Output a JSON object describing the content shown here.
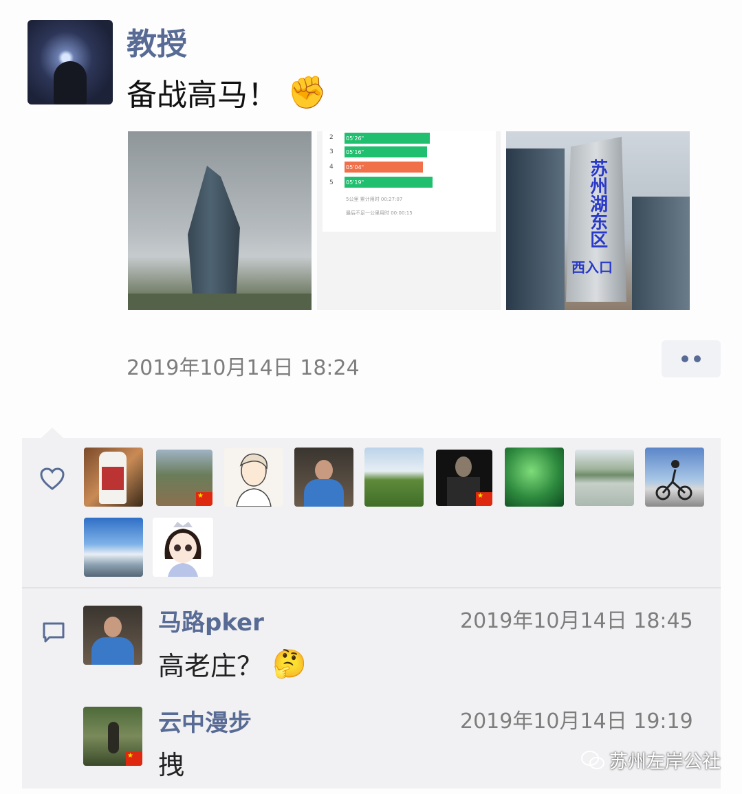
{
  "post": {
    "author": "教授",
    "text": "备战高马！",
    "emoji": "✊",
    "timestamp": "2019年10月14日 18:24",
    "photos": [
      {
        "name": "skyscraper-photo"
      },
      {
        "name": "running-stats-screenshot",
        "rows": [
          "2",
          "3",
          "4",
          "5"
        ],
        "values": [
          "05'26\"",
          "05'16\"",
          "05'04\"",
          "05'19\""
        ],
        "note1": "5公里 累计用时 00:27:07",
        "note2": "最后不足一公里用时 00:00:15"
      },
      {
        "name": "district-sign-photo",
        "sign_text": "苏州湖东区",
        "sign_bottom": "西入口"
      }
    ]
  },
  "likes": {
    "avatars": [
      "liquor-bottle",
      "city-aerial",
      "cartoon-boy",
      "man-blue-shirt",
      "field-landscape",
      "man-dark",
      "green-clover",
      "lake-trees",
      "cyclist",
      "sky-pier",
      "cartoon-girl"
    ]
  },
  "comments": [
    {
      "name": "马路pker",
      "time": "2019年10月14日 18:45",
      "text": "高老庄？",
      "emoji": "🤔"
    },
    {
      "name": "云中漫步",
      "time": "2019年10月14日 19:19",
      "text": "拽",
      "emoji": ""
    }
  ],
  "watermark": "苏州左岸公社",
  "colors": {
    "name_blue": "#576b95",
    "gray_text": "#7d7d7d",
    "panel_bg": "#f1f1f3"
  }
}
